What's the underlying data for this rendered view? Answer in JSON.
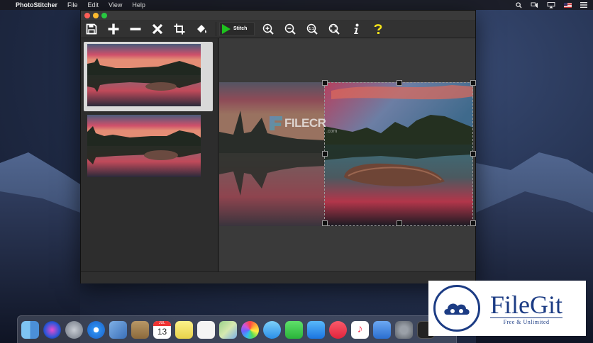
{
  "menubar": {
    "apple": "",
    "app_name": "PhotoStitcher",
    "items": [
      "File",
      "Edit",
      "View",
      "Help"
    ]
  },
  "toolbar": {
    "stitch_label": "Stitch",
    "stitch_color": "#1ec21e",
    "help_color": "#f2e21a",
    "tools": [
      "save-icon",
      "add-icon",
      "remove-icon",
      "delete-icon",
      "crop-icon",
      "fill-icon",
      "stitch",
      "zoom-in-icon",
      "zoom-out-icon",
      "zoom-actual-icon",
      "zoom-fit-icon",
      "info-icon",
      "help-icon"
    ],
    "zoom_actual_text": "1:1"
  },
  "thumbnails": [
    {
      "selected": true
    },
    {
      "selected": false
    }
  ],
  "dock": {
    "icons": [
      "finder-icon",
      "siri-icon",
      "launchpad-icon",
      "safari-icon",
      "mail-icon",
      "notes-icon",
      "calendar-icon",
      "stickies-icon",
      "reminders-icon",
      "maps-icon",
      "photos-icon",
      "messages-icon",
      "facetime-icon",
      "app-store-icon",
      "news-icon",
      "music-icon",
      "app-store-2-icon",
      "system-preferences-icon",
      "terminal-icon"
    ],
    "calendar_month": "JUL",
    "calendar_day": "13"
  },
  "watermark": {
    "filecr": "FILECR",
    "filecr_sub": ".com"
  },
  "badge": {
    "title": "FileGit",
    "subtitle": "Free & Unlimited",
    "color": "#1c3c84"
  }
}
